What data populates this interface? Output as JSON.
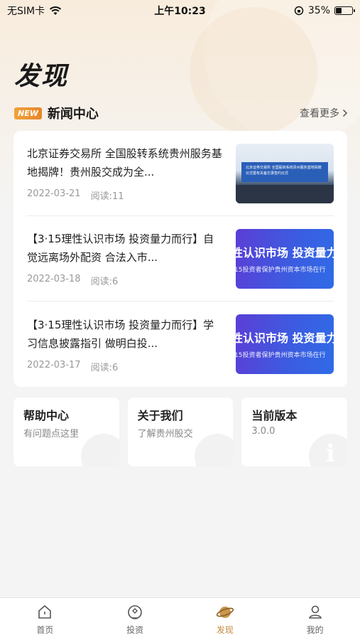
{
  "status_bar": {
    "carrier": "无SIM卡",
    "time": "上午10:23",
    "battery": "35%",
    "battery_level": 0.35
  },
  "page_title": "发现",
  "news_section": {
    "badge": "NEW",
    "title": "新闻中心",
    "more_label": "查看更多",
    "items": [
      {
        "title": "北京证券交易所 全国股转系统贵州服务基地揭牌！贵州股交成为全...",
        "date": "2022-03-21",
        "reads": "阅读:11",
        "thumb_caption": "北京证券交易所 全国股转系统贵州服务基地揭牌仪式暨有关备忘录签约仪式"
      },
      {
        "title": "【3·15理性认识市场 投资量力而行】自觉远离场外配资 合法入市...",
        "date": "2022-03-18",
        "reads": "阅读:6",
        "thumb_big": "性认识市场 投资量力而",
        "thumb_small": "15投资者保护贵州资本市场在行"
      },
      {
        "title": "【3·15理性认识市场 投资量力而行】学习信息披露指引 做明白投...",
        "date": "2022-03-17",
        "reads": "阅读:6",
        "thumb_big": "性认识市场 投资量力而",
        "thumb_small": "15投资者保护贵州资本市场在行"
      }
    ]
  },
  "tiles": [
    {
      "title": "帮助中心",
      "subtitle": "有问题点这里"
    },
    {
      "title": "关于我们",
      "subtitle": "了解贵州股交"
    },
    {
      "title": "当前版本",
      "subtitle": "3.0.0"
    }
  ],
  "tab_bar": {
    "items": [
      {
        "label": "首页",
        "icon": "home-icon"
      },
      {
        "label": "投资",
        "icon": "invest-icon"
      },
      {
        "label": "发现",
        "icon": "planet-icon",
        "active": true
      },
      {
        "label": "我的",
        "icon": "user-icon"
      }
    ]
  },
  "colors": {
    "accent": "#c28a3e",
    "badge": "#e8862a"
  }
}
